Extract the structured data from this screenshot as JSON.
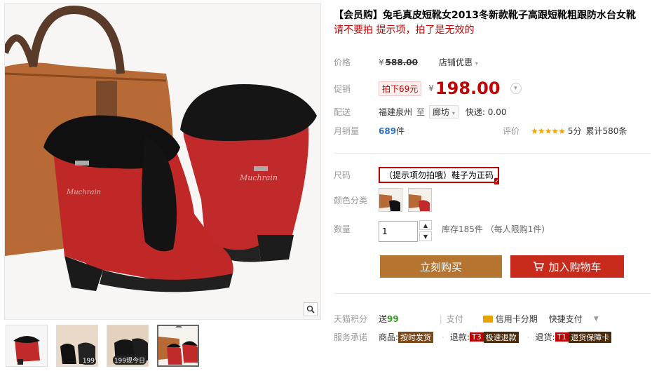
{
  "product": {
    "title": "【会员购】兔毛真皮短靴女2013冬新款靴子高跟短靴粗跟防水台女靴",
    "subtitle": "请不要拍 提示项，拍了是无效的"
  },
  "price": {
    "label": "价格",
    "currency": "¥",
    "original": "588.00",
    "discount_dropdown": "店铺优惠"
  },
  "promo": {
    "label": "促销",
    "badge": "拍下69元",
    "currency": "¥",
    "price": "198.00"
  },
  "delivery": {
    "label": "配送",
    "from": "福建泉州",
    "to_word": "至",
    "city": "廊坊",
    "shipping": "快递: 0.00"
  },
  "sales": {
    "label": "月销量",
    "count": "689",
    "unit": "件",
    "rating_label": "评价",
    "stars": "★★★★★",
    "score": "5分",
    "total_reviews": "累计580条"
  },
  "size": {
    "label": "尺码",
    "option": "（提示项勿拍哦）鞋子为正码"
  },
  "color": {
    "label": "颜色分类"
  },
  "quantity": {
    "label": "数量",
    "value": "1",
    "stock": "库存185件 （每人限购1件）"
  },
  "actions": {
    "buy": "立刻购买",
    "cart": "加入购物车"
  },
  "tmall": {
    "label": "天猫积分",
    "send": "送",
    "points": "99",
    "pay_label": "支付",
    "credit": "信用卡分期",
    "quick": "快捷支付"
  },
  "service": {
    "label": "服务承诺",
    "item1_prefix": "商品:",
    "item1_tag": "按时发货",
    "item2_prefix": "退款:",
    "item2_code": "T3",
    "item2_tag": "极速退款",
    "item3_prefix": "退货:",
    "item3_code": "T1",
    "item3_tag": "退货保障卡"
  },
  "thumbs": [
    {
      "tag": ""
    },
    {
      "tag": "199"
    },
    {
      "tag": "199现今日"
    },
    {
      "tag": ""
    }
  ],
  "main_image": {
    "brand_text": "Muchrain"
  },
  "colors": {
    "accent_red": "#c40000",
    "buy_brown": "#b5742f",
    "cart_red": "#c82a1c"
  }
}
